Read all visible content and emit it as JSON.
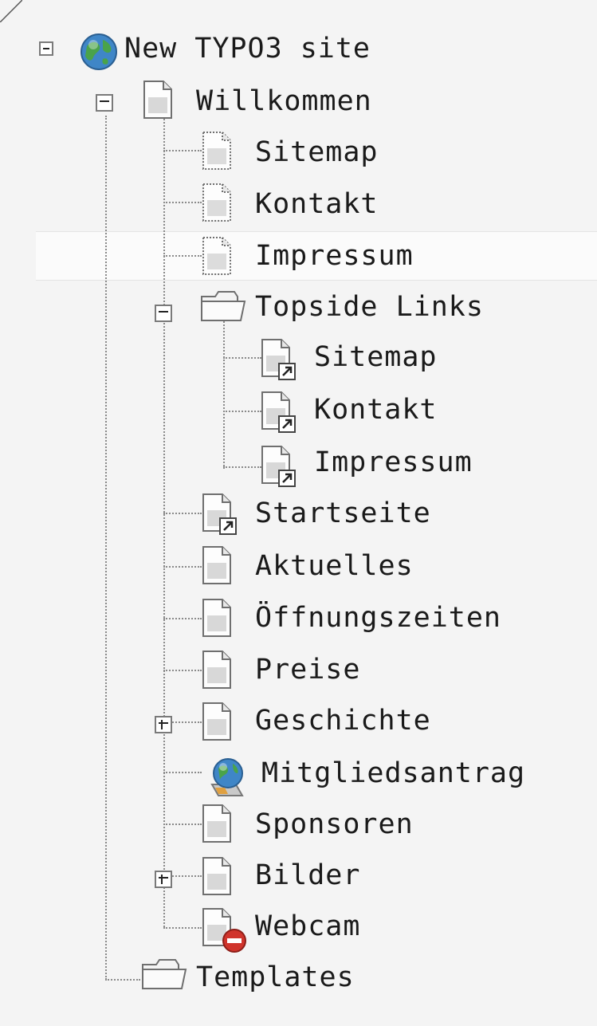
{
  "tree": {
    "root": {
      "label": "New TYPO3 site",
      "icon": "globe-icon",
      "expanded": true
    },
    "nodes": [
      {
        "label": "Willkommen",
        "icon": "page-icon",
        "expanded": true
      },
      {
        "label": "Sitemap",
        "icon": "hidden-page-icon"
      },
      {
        "label": "Kontakt",
        "icon": "hidden-page-icon"
      },
      {
        "label": "Impressum",
        "icon": "hidden-page-icon",
        "selected": true
      },
      {
        "label": "Topside Links",
        "icon": "folder-icon",
        "expanded": true
      },
      {
        "label": "Sitemap",
        "icon": "shortcut-page-icon"
      },
      {
        "label": "Kontakt",
        "icon": "shortcut-page-icon"
      },
      {
        "label": "Impressum",
        "icon": "shortcut-page-icon"
      },
      {
        "label": "Startseite",
        "icon": "shortcut-page-icon"
      },
      {
        "label": "Aktuelles",
        "icon": "page-icon"
      },
      {
        "label": "Öffnungszeiten",
        "icon": "page-icon"
      },
      {
        "label": "Preise",
        "icon": "page-icon"
      },
      {
        "label": "Geschichte",
        "icon": "page-icon",
        "expanded": false
      },
      {
        "label": "Mitgliedsantrag",
        "icon": "external-url-page-icon"
      },
      {
        "label": "Sponsoren",
        "icon": "page-icon"
      },
      {
        "label": "Bilder",
        "icon": "page-icon",
        "expanded": false
      },
      {
        "label": "Webcam",
        "icon": "restricted-page-icon"
      },
      {
        "label": "Templates",
        "icon": "folder-icon"
      }
    ]
  },
  "colors": {
    "background": "#f4f4f4",
    "selected_row": "#fbfbfb",
    "tree_line": "#8a8a8a",
    "text": "#1a1a1a"
  }
}
